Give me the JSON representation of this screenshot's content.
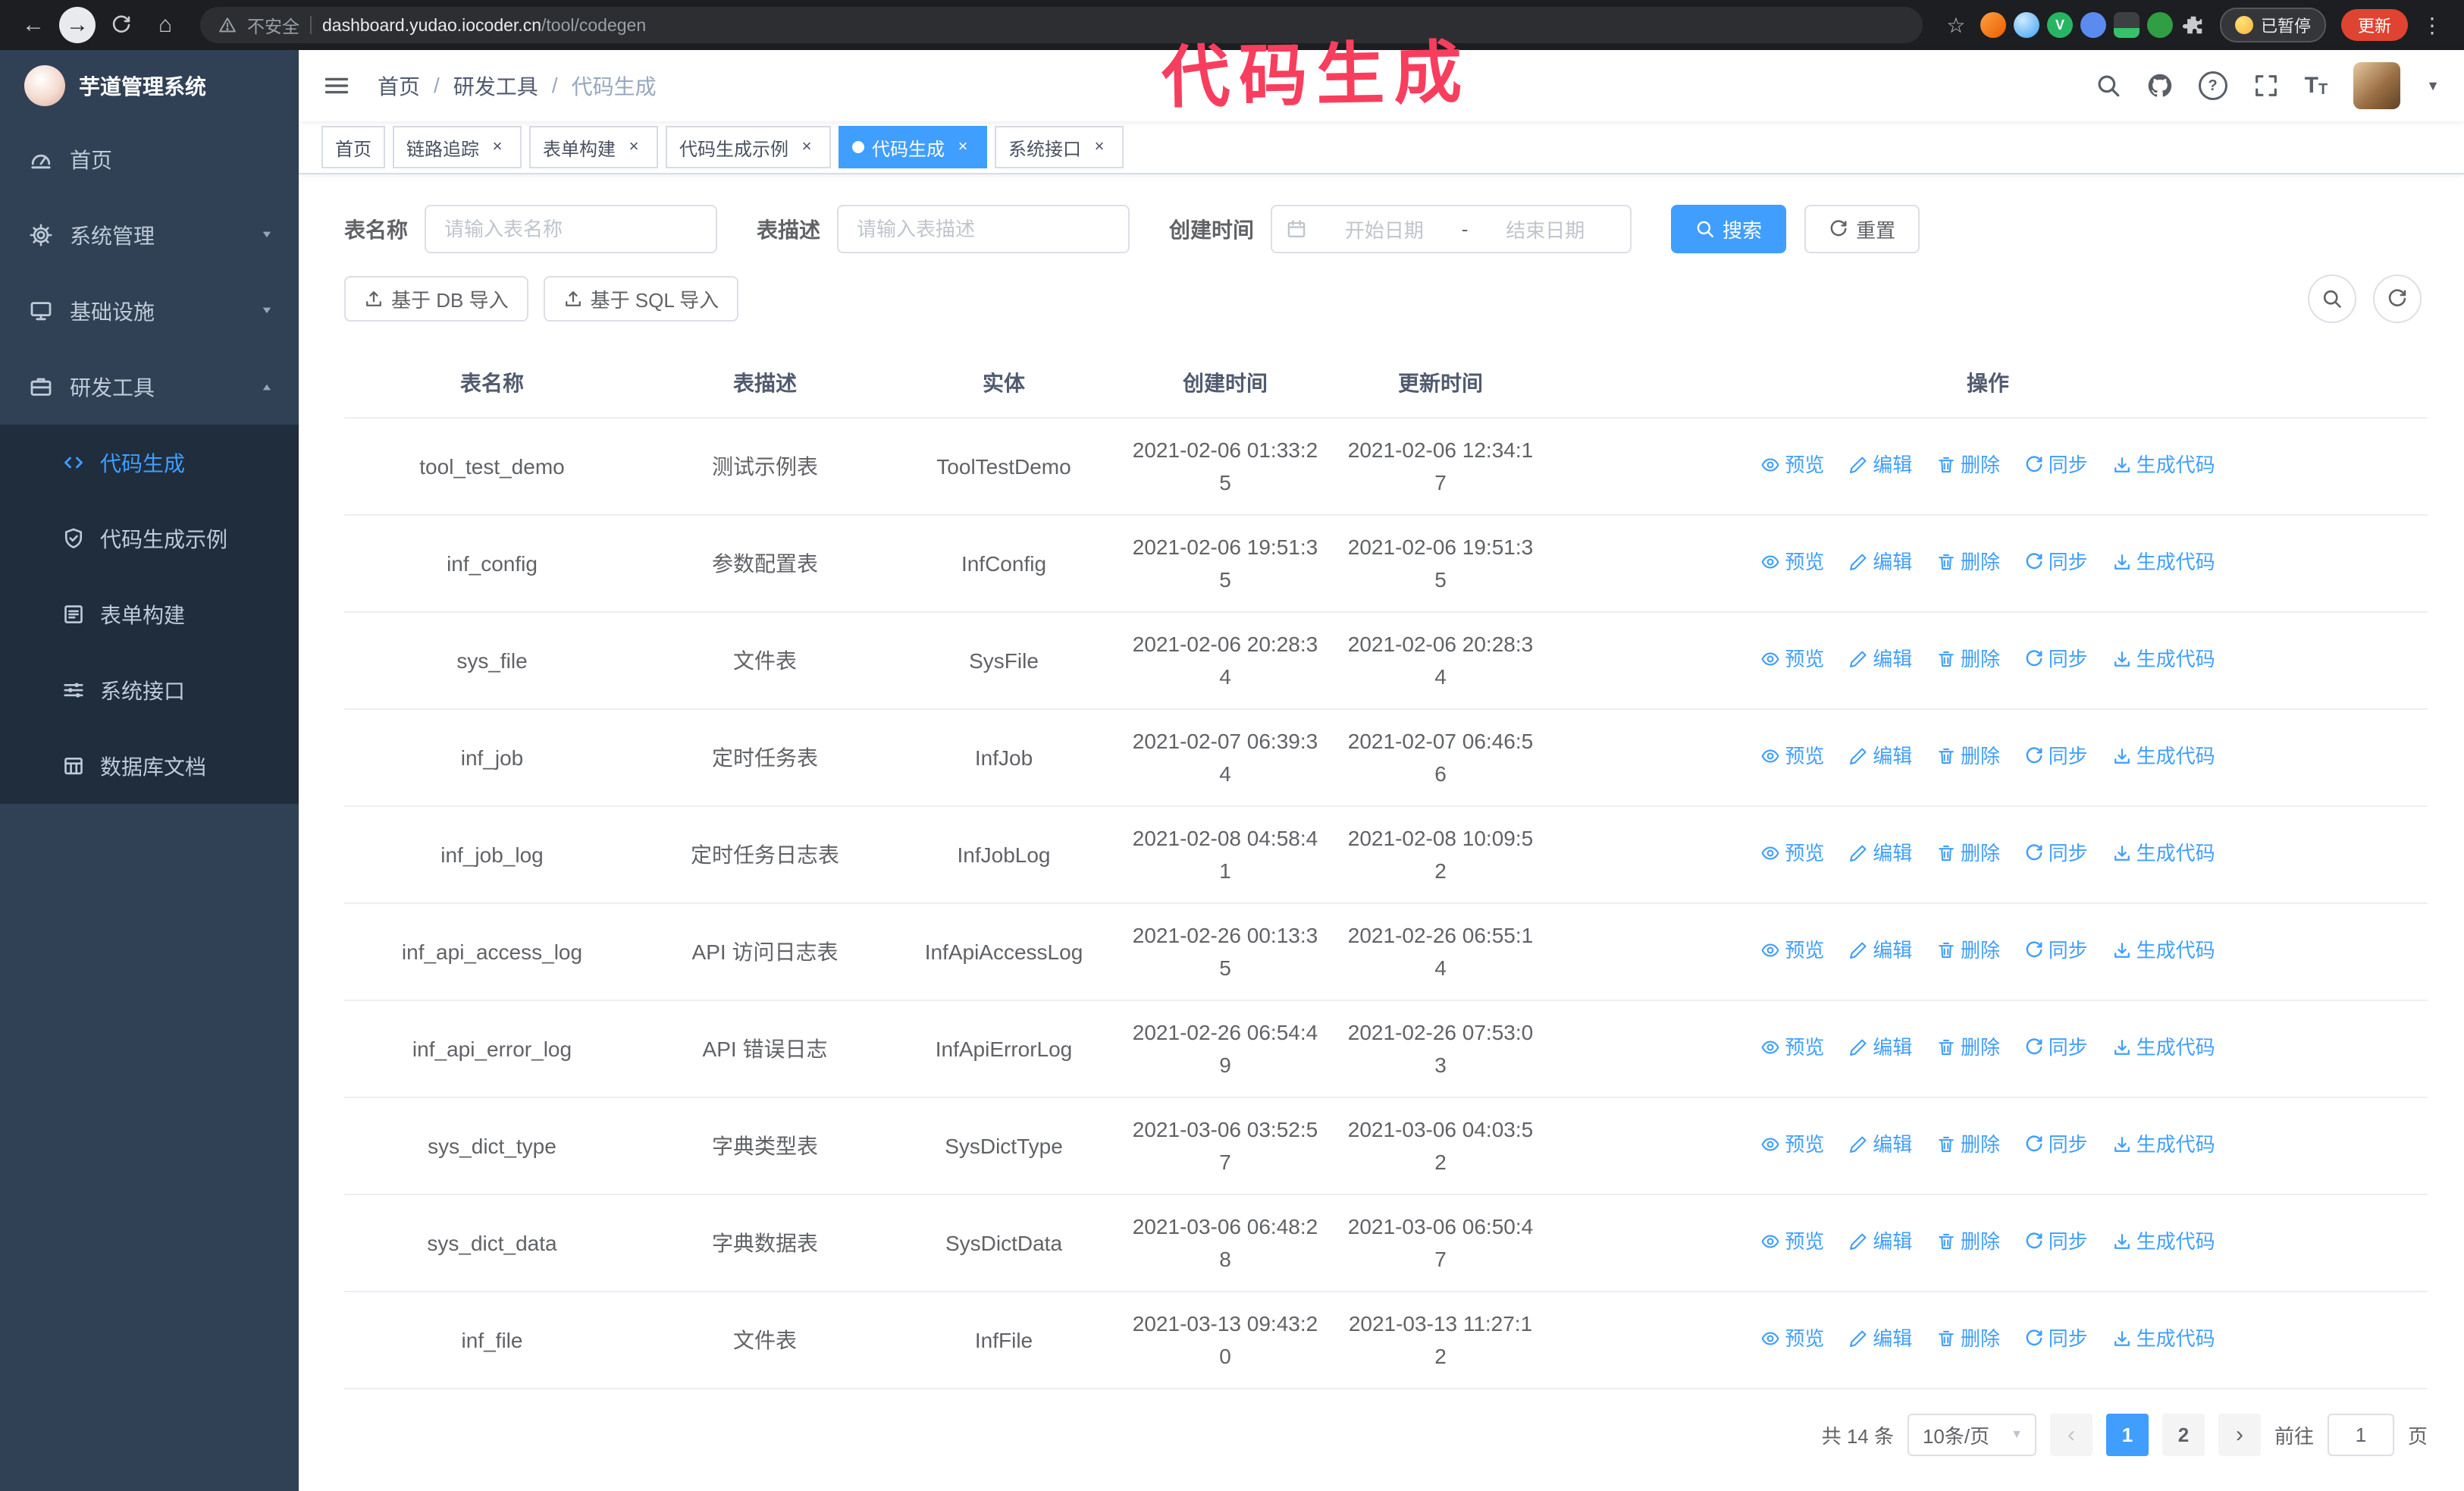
{
  "browser": {
    "security_label": "不安全",
    "url_domain": "dashboard.yudao.iocoder.cn",
    "url_path": "/tool/codegen",
    "paused_badge": "已暂停",
    "update_button": "更新"
  },
  "annotation_text": "代码生成",
  "sidebar": {
    "logo_title": "芋道管理系统",
    "items": [
      {
        "label": "首页"
      },
      {
        "label": "系统管理"
      },
      {
        "label": "基础设施"
      },
      {
        "label": "研发工具"
      }
    ],
    "submenu": [
      {
        "label": "代码生成"
      },
      {
        "label": "代码生成示例"
      },
      {
        "label": "表单构建"
      },
      {
        "label": "系统接口"
      },
      {
        "label": "数据库文档"
      }
    ]
  },
  "header": {
    "breadcrumb": [
      "首页",
      "研发工具",
      "代码生成"
    ]
  },
  "tabs": [
    {
      "label": "首页"
    },
    {
      "label": "链路追踪"
    },
    {
      "label": "表单构建"
    },
    {
      "label": "代码生成示例"
    },
    {
      "label": "代码生成"
    },
    {
      "label": "系统接口"
    }
  ],
  "filters": {
    "table_name_label": "表名称",
    "table_name_placeholder": "请输入表名称",
    "table_desc_label": "表描述",
    "table_desc_placeholder": "请输入表描述",
    "create_time_label": "创建时间",
    "date_start_placeholder": "开始日期",
    "date_end_placeholder": "结束日期",
    "search_button": "搜索",
    "reset_button": "重置"
  },
  "toolbar": {
    "import_db": "基于 DB 导入",
    "import_sql": "基于 SQL 导入"
  },
  "table": {
    "columns": [
      "表名称",
      "表描述",
      "实体",
      "创建时间",
      "更新时间",
      "操作"
    ],
    "actions": [
      "预览",
      "编辑",
      "删除",
      "同步",
      "生成代码"
    ],
    "rows": [
      {
        "name": "tool_test_demo",
        "desc": "测试示例表",
        "entity": "ToolTestDemo",
        "created": "2021-02-06 01:33:25",
        "updated": "2021-02-06 12:34:17"
      },
      {
        "name": "inf_config",
        "desc": "参数配置表",
        "entity": "InfConfig",
        "created": "2021-02-06 19:51:35",
        "updated": "2021-02-06 19:51:35"
      },
      {
        "name": "sys_file",
        "desc": "文件表",
        "entity": "SysFile",
        "created": "2021-02-06 20:28:34",
        "updated": "2021-02-06 20:28:34"
      },
      {
        "name": "inf_job",
        "desc": "定时任务表",
        "entity": "InfJob",
        "created": "2021-02-07 06:39:34",
        "updated": "2021-02-07 06:46:56"
      },
      {
        "name": "inf_job_log",
        "desc": "定时任务日志表",
        "entity": "InfJobLog",
        "created": "2021-02-08 04:58:41",
        "updated": "2021-02-08 10:09:52"
      },
      {
        "name": "inf_api_access_log",
        "desc": "API 访问日志表",
        "entity": "InfApiAccessLog",
        "created": "2021-02-26 00:13:35",
        "updated": "2021-02-26 06:55:14"
      },
      {
        "name": "inf_api_error_log",
        "desc": "API 错误日志",
        "entity": "InfApiErrorLog",
        "created": "2021-02-26 06:54:49",
        "updated": "2021-02-26 07:53:03"
      },
      {
        "name": "sys_dict_type",
        "desc": "字典类型表",
        "entity": "SysDictType",
        "created": "2021-03-06 03:52:57",
        "updated": "2021-03-06 04:03:52"
      },
      {
        "name": "sys_dict_data",
        "desc": "字典数据表",
        "entity": "SysDictData",
        "created": "2021-03-06 06:48:28",
        "updated": "2021-03-06 06:50:47"
      },
      {
        "name": "inf_file",
        "desc": "文件表",
        "entity": "InfFile",
        "created": "2021-03-13 09:43:20",
        "updated": "2021-03-13 11:27:12"
      }
    ]
  },
  "pagination": {
    "total": "共 14 条",
    "page_size": "10条/页",
    "page1": "1",
    "page2": "2",
    "goto_label": "前往",
    "goto_value": "1",
    "goto_suffix": "页"
  },
  "glyphs": {
    "close": "×",
    "caret_down": "▼",
    "back": "←",
    "forward": "→",
    "home": "⌂",
    "star": "☆",
    "dots": "⋮",
    "prev": "‹",
    "next": "›",
    "slash": "/",
    "dash": "-",
    "font_size": "T",
    "ext_v": "V"
  },
  "colors": {
    "accent": "#409eff",
    "annotation": "#f83e5e",
    "sidebar_bg": "#304156",
    "submenu_bg": "#1f2d3d"
  }
}
